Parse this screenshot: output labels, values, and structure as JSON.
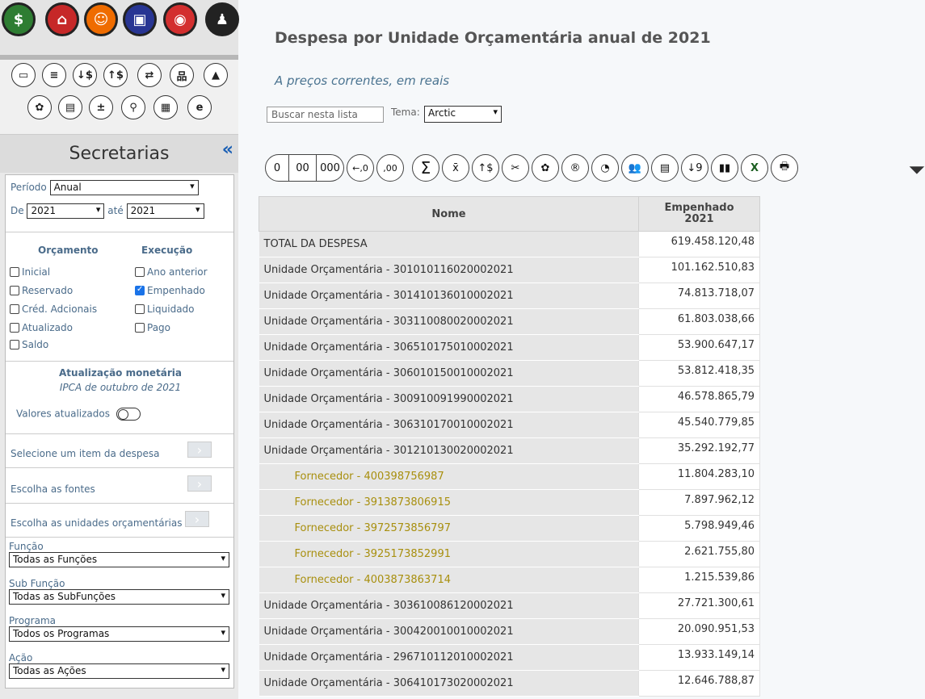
{
  "sidebar": {
    "panel_title": "Secretarias",
    "collapse_icon": "«",
    "periodo_label": "Período",
    "periodo_value": "Anual",
    "de_label": "De",
    "de_value": "2021",
    "ate_label": "até",
    "ate_value": "2021",
    "orcamento_head": "Orçamento",
    "execucao_head": "Execução",
    "orcamento_items": [
      {
        "label": "Inicial",
        "checked": false
      },
      {
        "label": "Reservado",
        "checked": false
      },
      {
        "label": "Créd. Adcionais",
        "checked": false
      },
      {
        "label": "Atualizado",
        "checked": false
      },
      {
        "label": "Saldo",
        "checked": false
      }
    ],
    "execucao_items": [
      {
        "label": "Ano anterior",
        "checked": false
      },
      {
        "label": "Empenhado",
        "checked": true
      },
      {
        "label": "Liquidado",
        "checked": false
      },
      {
        "label": "Pago",
        "checked": false
      }
    ],
    "atualizacao_title": "Atualização monetária",
    "atualizacao_sub": "IPCA de outubro de 2021",
    "valores_label": "Valores atualizados",
    "selecione_item": "Selecione um item da despesa",
    "escolha_fontes": "Escolha as fontes",
    "escolha_unidades": "Escolha as unidades orçamentárias",
    "funcao_label": "Função",
    "funcao_value": "Todas as Funções",
    "subfuncao_label": "Sub Função",
    "subfuncao_value": "Todas as SubFunções",
    "programa_label": "Programa",
    "programa_value": "Todos os Programas",
    "acao_label": "Ação",
    "acao_value": "Todas as Ações"
  },
  "main": {
    "title": "Despesa por Unidade Orçamentária anual de 2021",
    "subtitle": "A preços correntes, em reais",
    "search_placeholder": "Buscar nesta lista",
    "tema_label": "Tema:",
    "tema_value": "Arctic",
    "toolbar": [
      "0",
      "00",
      "000",
      "←,0",
      ",00",
      "Σ",
      "x̄",
      "↑$",
      "✂",
      "✿",
      "®",
      "◔",
      "👥",
      "▤",
      "↓9",
      "▮▮",
      "X",
      "🖶"
    ],
    "table": {
      "col_nome": "Nome",
      "col_emp_line1": "Empenhado",
      "col_emp_line2": "2021",
      "rows": [
        {
          "nome": "TOTAL DA DESPESA",
          "valor": "619.458.120,48",
          "sub": false
        },
        {
          "nome": "Unidade Orçamentária - 301010116020002021",
          "valor": "101.162.510,83",
          "sub": false
        },
        {
          "nome": "Unidade Orçamentária - 301410136010002021",
          "valor": "74.813.718,07",
          "sub": false
        },
        {
          "nome": "Unidade Orçamentária - 303110080020002021",
          "valor": "61.803.038,66",
          "sub": false
        },
        {
          "nome": "Unidade Orçamentária - 306510175010002021",
          "valor": "53.900.647,17",
          "sub": false
        },
        {
          "nome": "Unidade Orçamentária - 306010150010002021",
          "valor": "53.812.418,35",
          "sub": false
        },
        {
          "nome": "Unidade Orçamentária - 300910091990002021",
          "valor": "46.578.865,79",
          "sub": false
        },
        {
          "nome": "Unidade Orçamentária - 306310170010002021",
          "valor": "45.540.779,85",
          "sub": false
        },
        {
          "nome": "Unidade Orçamentária - 301210130020002021",
          "valor": "35.292.192,77",
          "sub": false
        },
        {
          "nome": "Fornecedor - 400398756987",
          "valor": "11.804.283,10",
          "sub": true
        },
        {
          "nome": "Fornecedor - 3913873806915",
          "valor": "7.897.962,12",
          "sub": true
        },
        {
          "nome": "Fornecedor - 3972573856797",
          "valor": "5.798.949,46",
          "sub": true
        },
        {
          "nome": "Fornecedor - 3925173852991",
          "valor": "2.621.755,80",
          "sub": true
        },
        {
          "nome": "Fornecedor - 4003873863714",
          "valor": "1.215.539,86",
          "sub": true
        },
        {
          "nome": "Unidade Orçamentária - 303610086120002021",
          "valor": "27.721.300,61",
          "sub": false
        },
        {
          "nome": "Unidade Orçamentária - 300420010010002021",
          "valor": "20.090.951,53",
          "sub": false
        },
        {
          "nome": "Unidade Orçamentária - 296710112010002021",
          "valor": "13.933.149,14",
          "sub": false
        },
        {
          "nome": "Unidade Orçamentária - 306410173020002021",
          "valor": "12.646.788,87",
          "sub": false
        }
      ]
    }
  },
  "colors": {
    "sub_row_text": "#a88f0e",
    "label_blue": "#4a6b8a",
    "collapse_blue": "#1a5fb4"
  }
}
